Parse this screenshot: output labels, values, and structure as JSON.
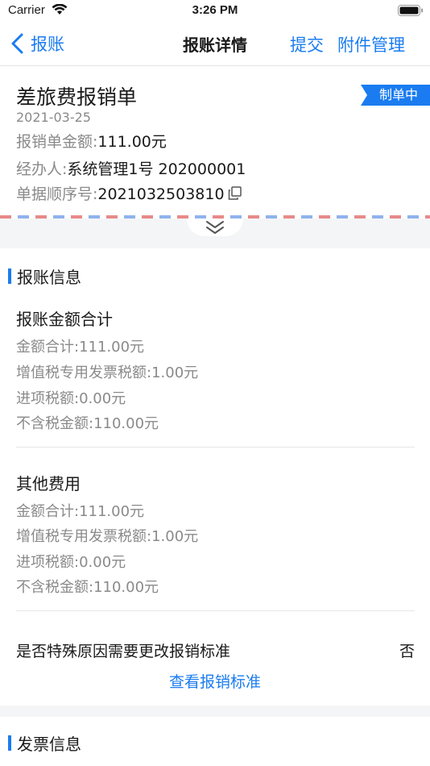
{
  "status_bar": {
    "carrier": "Carrier",
    "time": "3:26 PM"
  },
  "nav": {
    "back_label": "报账",
    "title": "报账详情",
    "submit_label": "提交",
    "attachments_label": "附件管理"
  },
  "document": {
    "title": "差旅费报销单",
    "status": "制单中",
    "date": "2021-03-25",
    "amount_label": "报销单金额:",
    "amount_value": "111.00元",
    "handler_label": "经办人:",
    "handler_value": "系统管理1号 202000001",
    "serial_label": "单据顺序号:",
    "serial_value": "2021032503810"
  },
  "sections": {
    "reimbursement_info": "报账信息",
    "invoice_info": "发票信息"
  },
  "groups": [
    {
      "title": "报账金额合计",
      "lines": [
        "金额合计:111.00元",
        "增值税专用发票税额:1.00元",
        "进项税额:0.00元",
        "不含税金额:110.00元"
      ]
    },
    {
      "title": "其他费用",
      "lines": [
        "金额合计:111.00元",
        "增值税专用发票税额:1.00元",
        "进项税额:0.00元",
        "不含税金额:110.00元"
      ]
    }
  ],
  "special_reason": {
    "question": "是否特殊原因需要更改报销标准",
    "answer": "否",
    "link": "查看报销标准"
  },
  "colors": {
    "accent": "#1a7cf0",
    "muted": "#8a8a8a",
    "band": "#f4f5f7"
  }
}
